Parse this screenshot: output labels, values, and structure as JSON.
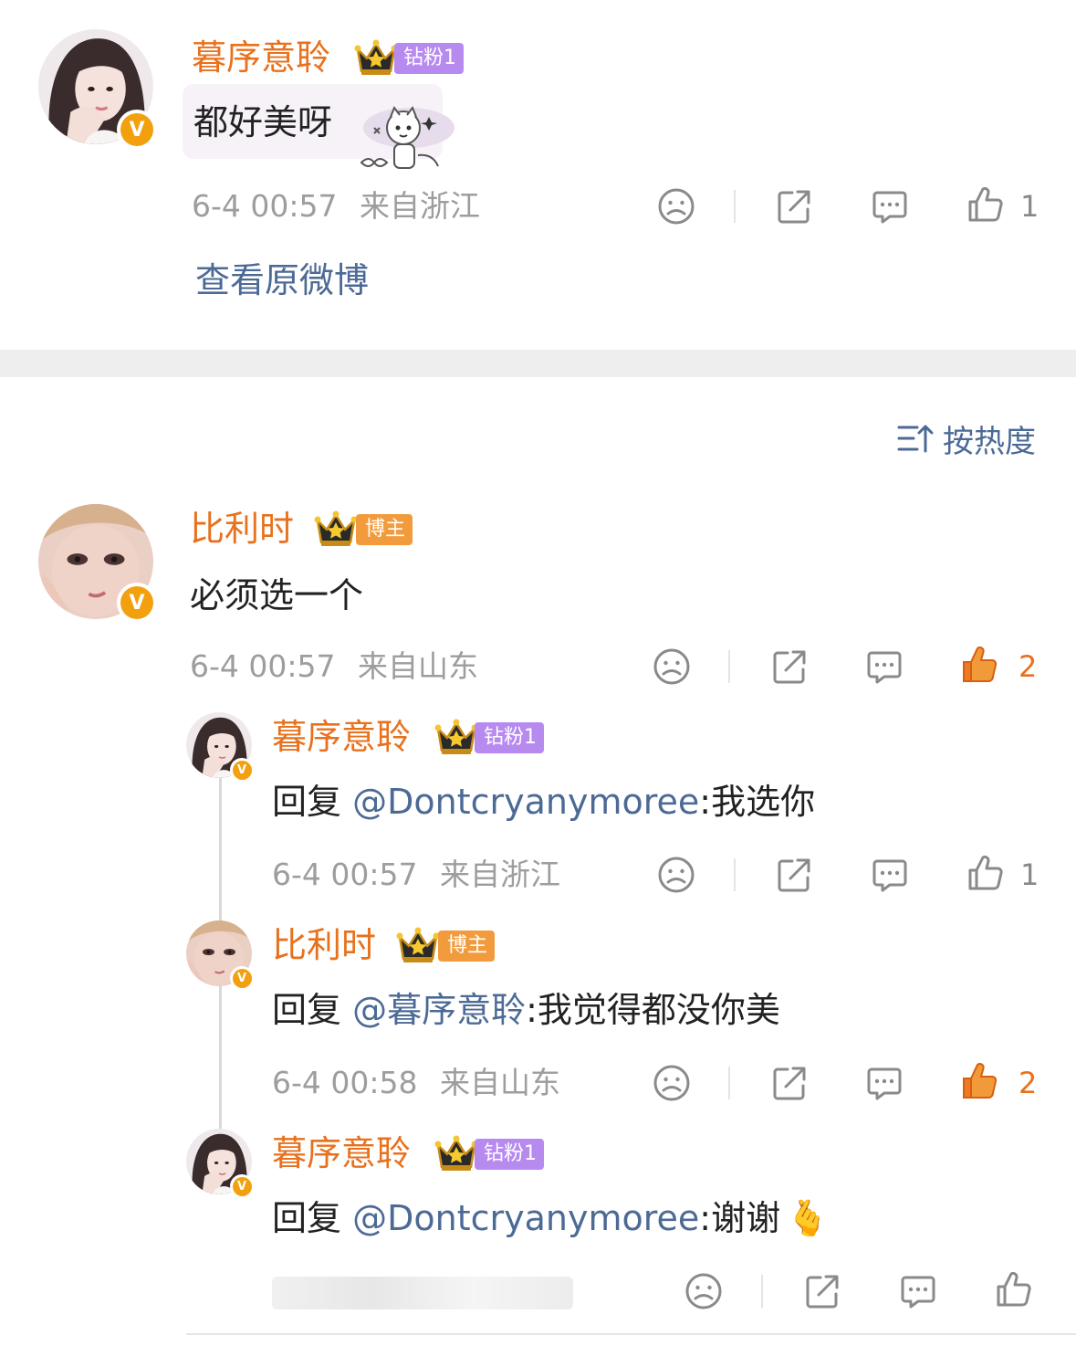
{
  "colors": {
    "username": "#e8711d",
    "mention": "#4c6a96",
    "meta": "#9d9d9d",
    "fan_badge": "#b78af0",
    "host_badge": "#f29b3d",
    "liked": "#e8711d",
    "verified": "#f3a00e"
  },
  "icons": {
    "verified": "V",
    "dislike": "sad-face-icon",
    "share": "share-icon",
    "comment": "comment-icon",
    "like": "thumbs-up-icon"
  },
  "top_comment": {
    "username": "暮序意聆",
    "badge": "钻粉1",
    "text": "都好美呀",
    "time": "6-4 00:57",
    "location": "来自浙江",
    "likes": "1",
    "view_original": "查看原微博"
  },
  "sort": {
    "label": "按热度"
  },
  "main_comment": {
    "username": "比利时",
    "badge": "博主",
    "text": "必须选一个",
    "time": "6-4 00:57",
    "location": "来自山东",
    "likes": "2"
  },
  "replies": [
    {
      "username": "暮序意聆",
      "badge": "钻粉1",
      "prefix": "回复 ",
      "mention": "@Dontcryanymoree",
      "text": ":我选你",
      "time": "6-4 00:57",
      "location": "来自浙江",
      "likes": "1"
    },
    {
      "username": "比利时",
      "badge": "博主",
      "prefix": "回复 ",
      "mention": "@暮序意聆",
      "text": ":我觉得都没你美",
      "time": "6-4 00:58",
      "location": "来自山东",
      "likes": "2"
    },
    {
      "username": "暮序意聆",
      "badge": "钻粉1",
      "prefix": "回复 ",
      "mention": "@Dontcryanymoree",
      "text": ":谢谢",
      "emoji": "🫰"
    }
  ]
}
